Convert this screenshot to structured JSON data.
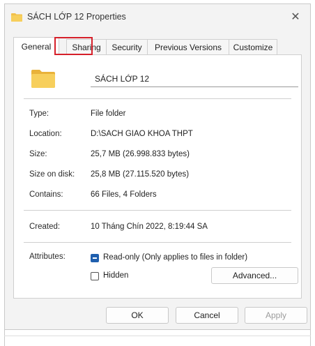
{
  "window": {
    "title": "SÁCH LỚP 12 Properties",
    "close_glyph": "✕",
    "folder_color": "#f2c14b"
  },
  "tabs": [
    {
      "label": "General",
      "active": true
    },
    {
      "label": "Sharing",
      "highlighted": true
    },
    {
      "label": "Security"
    },
    {
      "label": "Previous Versions"
    },
    {
      "label": "Customize"
    }
  ],
  "general": {
    "folder_name": "SÁCH LỚP 12",
    "type_label": "Type:",
    "type_value": "File folder",
    "location_label": "Location:",
    "location_value": "D:\\SACH GIAO KHOA THPT",
    "size_label": "Size:",
    "size_value": "25,7 MB (26.998.833 bytes)",
    "size_on_disk_label": "Size on disk:",
    "size_on_disk_value": "25,8 MB (27.115.520 bytes)",
    "contains_label": "Contains:",
    "contains_value": "66 Files, 4 Folders",
    "created_label": "Created:",
    "created_value": "10 Tháng Chín 2022, 8:19:44 SA",
    "attributes_label": "Attributes:",
    "readonly_label": "Read-only (Only applies to files in folder)",
    "hidden_label": "Hidden",
    "advanced_label": "Advanced..."
  },
  "footer": {
    "ok_label": "OK",
    "cancel_label": "Cancel",
    "apply_label": "Apply"
  },
  "colors": {
    "accent": "#1f5fae",
    "highlight_outline": "#d6202a"
  }
}
